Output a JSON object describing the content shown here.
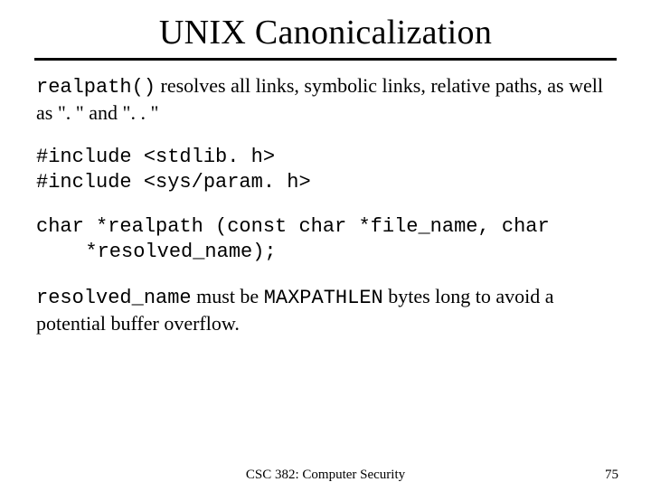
{
  "title": "UNIX Canonicalization",
  "p1": {
    "code": "realpath()",
    "rest": " resolves all links, symbolic links, relative paths, as well as \". \" and \". . \""
  },
  "includes": "#include <stdlib. h>\n#include <sys/param. h>",
  "proto": "char *realpath (const char *file_name, char\n  *resolved_name);",
  "p2": {
    "c1": "resolved_name",
    "t1": " must be ",
    "c2": "MAXPATHLEN",
    "t2": " bytes long to avoid a potential buffer overflow."
  },
  "footer": {
    "center": "CSC 382: Computer Security",
    "right": "75"
  }
}
